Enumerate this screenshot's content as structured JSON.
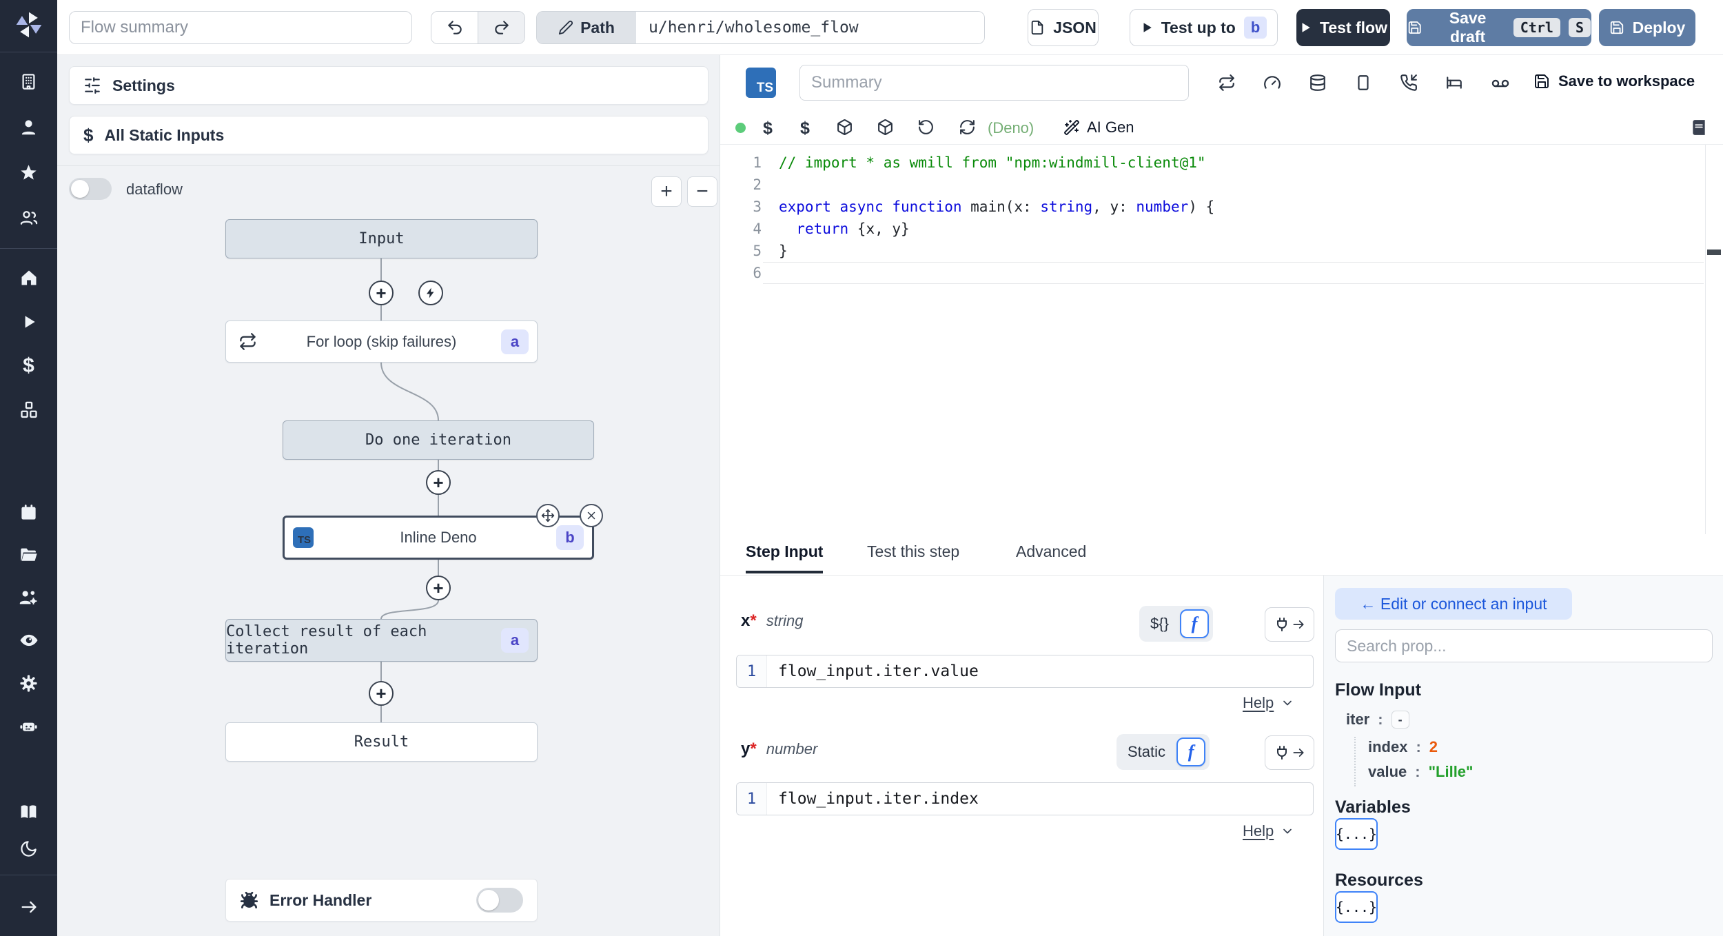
{
  "topbar": {
    "flow_summary_placeholder": "Flow summary",
    "path_label": "Path",
    "path_value": "u/henri/wholesome_flow",
    "json_button": "JSON",
    "test_up_to": "Test up to",
    "test_up_to_badge": "b",
    "test_flow": "Test flow",
    "save_draft": "Save draft",
    "kbd_ctrl": "Ctrl",
    "kbd_s": "S",
    "deploy": "Deploy"
  },
  "flow_panel": {
    "settings": "Settings",
    "all_static_inputs": "All Static Inputs",
    "dataflow_label": "dataflow",
    "zoom_in": "+",
    "zoom_out": "−",
    "nodes": {
      "input": "Input",
      "for_loop": "For loop (skip failures)",
      "for_loop_badge": "a",
      "do_one_iteration": "Do one iteration",
      "inline_deno": "Inline Deno",
      "inline_deno_badge": "b",
      "inline_deno_lang": "TS",
      "collect": "Collect result of each iteration",
      "collect_badge": "a",
      "result": "Result",
      "error_handler": "Error Handler"
    }
  },
  "editor": {
    "lang_badge": "TS",
    "summary_placeholder": "Summary",
    "save_to_workspace": "Save to workspace",
    "lang_hint": "(Deno)",
    "ai_gen": "AI Gen",
    "gutter": [
      "1",
      "2",
      "3",
      "4",
      "5",
      "6"
    ],
    "code": {
      "lines": [
        [
          {
            "c": "cm",
            "t": "// import * as wmill from \"npm:windmill-client@1\""
          }
        ],
        [],
        [
          {
            "c": "kw",
            "t": "export async function"
          },
          {
            "c": "pl",
            "t": " main(x: "
          },
          {
            "c": "kw",
            "t": "string"
          },
          {
            "c": "pl",
            "t": ", y: "
          },
          {
            "c": "kw",
            "t": "number"
          },
          {
            "c": "pl",
            "t": ") {"
          }
        ],
        [
          {
            "c": "pl",
            "t": "  "
          },
          {
            "c": "kw",
            "t": "return"
          },
          {
            "c": "pl",
            "t": " {x, y}"
          }
        ],
        [
          {
            "c": "pl",
            "t": "}"
          }
        ],
        []
      ]
    }
  },
  "tabs": {
    "step_input": "Step Input",
    "test_this_step": "Test this step",
    "advanced": "Advanced"
  },
  "step_input": {
    "x_name": "x",
    "x_required": "*",
    "x_type": "string",
    "x_toggle_left": "${}",
    "x_toggle_right": "f",
    "x_line": "1",
    "x_expr": "flow_input.iter.value",
    "x_help": "Help",
    "y_name": "y",
    "y_required": "*",
    "y_type": "number",
    "y_toggle_left": "Static",
    "y_toggle_right": "f",
    "y_line": "1",
    "y_expr": "flow_input.iter.index",
    "y_help": "Help"
  },
  "connect_panel": {
    "edit_button": "← Edit or connect an input",
    "search_placeholder": "Search prop...",
    "flow_input_title": "Flow Input",
    "tree": {
      "iter_key": "iter",
      "colon": ":",
      "collapse": "-",
      "index_key": "index",
      "index_value": "2",
      "value_key": "value",
      "value_value": "\"Lille\""
    },
    "variables_title": "Variables",
    "variables_button": "{...}",
    "resources_title": "Resources",
    "resources_button": "{...}"
  },
  "colors": {
    "accent_blue": "#3f83f8",
    "muted_button_blue": "#5e7ca4",
    "dark_button": "#27303f",
    "badge_indigo_bg": "#e1e6fd",
    "badge_indigo_text": "#4a44c6",
    "ts_badge_blue": "#2e6fb8",
    "status_green": "#5ccc7a",
    "deno_green": "#74ae74",
    "value_orange": "#ea5a0c",
    "value_green": "#23a02b"
  }
}
